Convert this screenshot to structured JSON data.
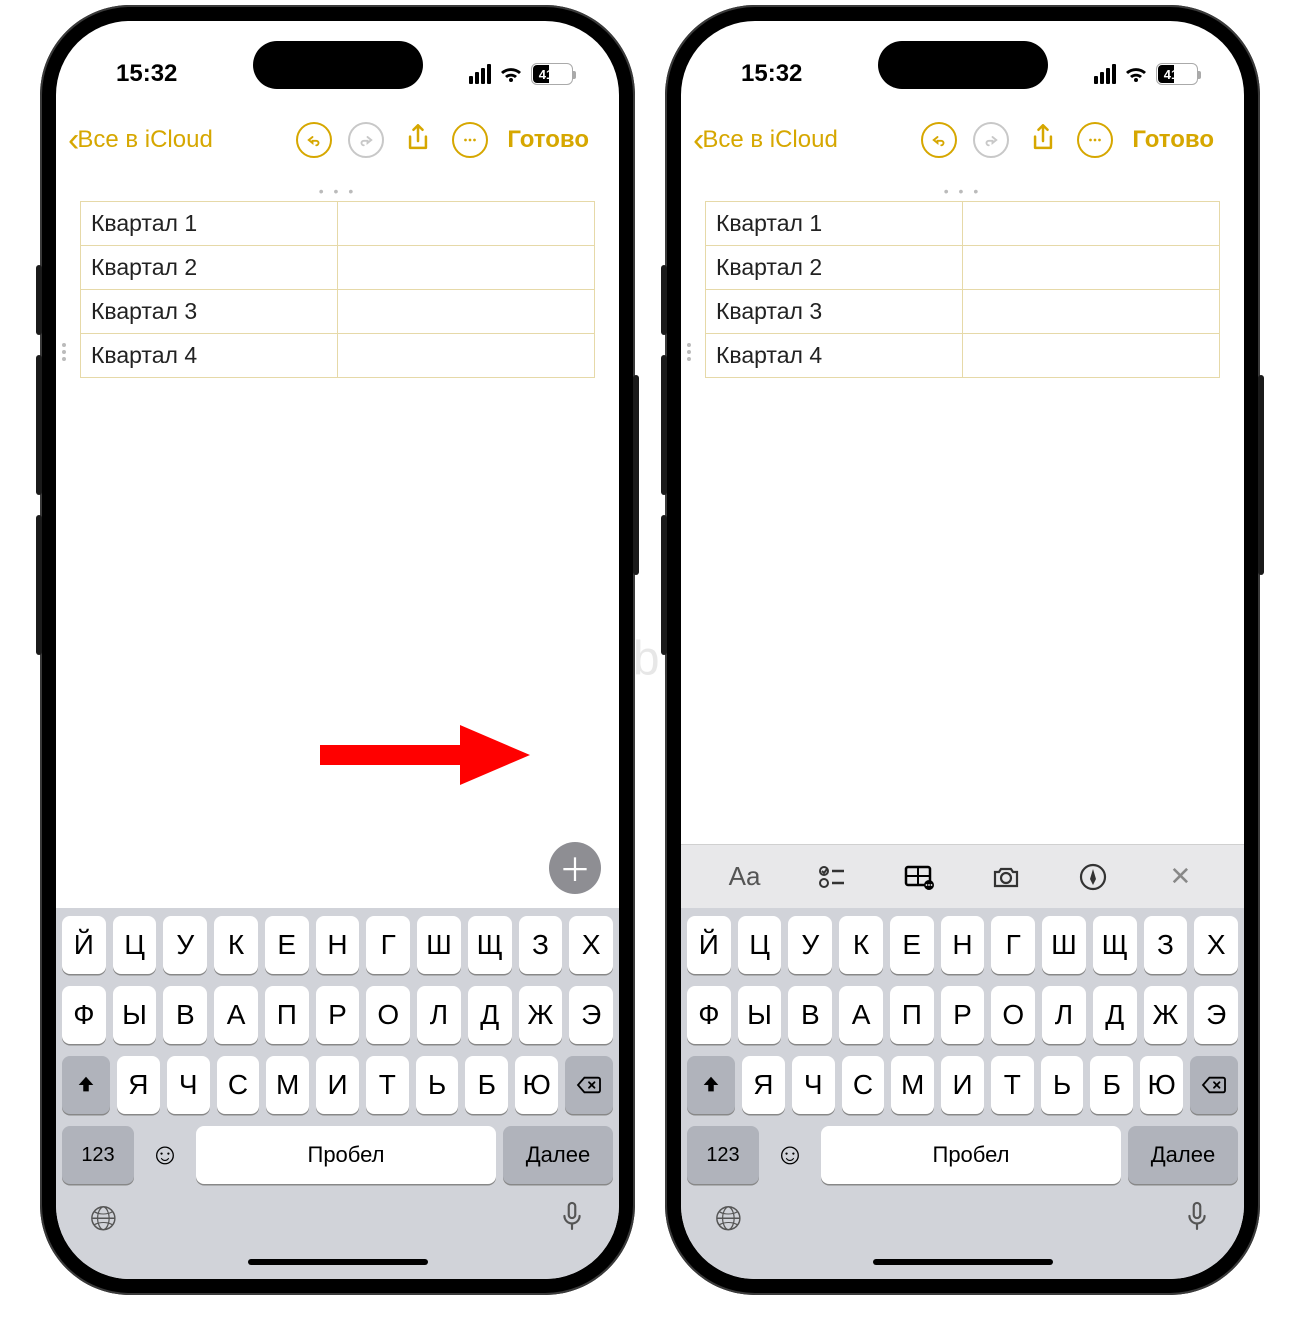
{
  "statusbar": {
    "time": "15:32",
    "battery_percent": "41"
  },
  "navbar": {
    "back_label": "Все в iCloud",
    "done_label": "Готово"
  },
  "table": {
    "rows": [
      {
        "c1": "Квартал 1",
        "c2": ""
      },
      {
        "c1": "Квартал 2",
        "c2": ""
      },
      {
        "c1": "Квартал 3",
        "c2": ""
      },
      {
        "c1": "Квартал 4",
        "c2": ""
      }
    ]
  },
  "toolbar": {
    "text_style": "Aa"
  },
  "keyboard": {
    "row1": [
      "Й",
      "Ц",
      "У",
      "К",
      "Е",
      "Н",
      "Г",
      "Ш",
      "Щ",
      "З",
      "Х"
    ],
    "row2": [
      "Ф",
      "Ы",
      "В",
      "А",
      "П",
      "Р",
      "О",
      "Л",
      "Д",
      "Ж",
      "Э"
    ],
    "row3": [
      "Я",
      "Ч",
      "С",
      "М",
      "И",
      "Т",
      "Ь",
      "Б",
      "Ю"
    ],
    "numkey": "123",
    "space": "Пробел",
    "next": "Далее"
  },
  "watermark": "Yablyk"
}
